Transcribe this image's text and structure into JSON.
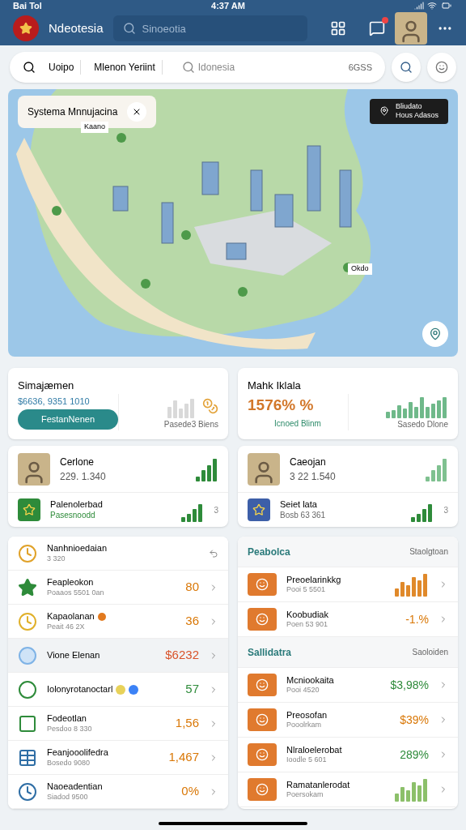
{
  "status_bar": {
    "carrier": "Bai Tol",
    "time": "4:37 AM"
  },
  "app_bar": {
    "title": "Ndeotesia",
    "search": {
      "placeholder": "Sinoeotia"
    },
    "notification_badge": true
  },
  "filter_bar": {
    "items": [
      "Uoipo",
      "Mlenon Yeriint"
    ],
    "search": {
      "placeholder": "Idonesia"
    },
    "count": "6GSS"
  },
  "map": {
    "title": "Systema Mnnujacina",
    "info": {
      "line_1": "Bliudato",
      "line_2": "Hous Adasos"
    },
    "labels": [
      "Kaano",
      "Okdo"
    ]
  },
  "stats": [
    {
      "kind": "button",
      "title": "Simajæmen",
      "value": "$6636, 9351 1010",
      "button": "FestanNenen",
      "caption": "Pasede3 Biens"
    },
    {
      "kind": "link",
      "title": "Mahk Iklala",
      "value": "1576% %",
      "link": "Icnoed Blinm",
      "caption": "Sasedo Dlone"
    }
  ],
  "people": [
    {
      "name": "Cerlone",
      "value": "229. 1.340",
      "sub_title": "Palenolerbad",
      "sub_value": "Pasesnoodd",
      "count": "3"
    },
    {
      "name": "Caeojan",
      "value": "3 22 1.540",
      "sub_title": "Seiet lata",
      "sub_value": "Bosb 63 361",
      "count": "3"
    }
  ],
  "left_list": [
    {
      "title": "Nanhnioedaian",
      "subtitle": "3 320",
      "selected": false
    },
    {
      "title": "Feapleokon",
      "subtitle": "Poaaos 5501 0an",
      "value": "80",
      "color": "#d97706",
      "selected": false
    },
    {
      "title": "Kapaolanan",
      "subtitle": "Peait 46 2X",
      "value": "36",
      "color": "#d97706",
      "selected": false
    },
    {
      "title": "Vione Elenan",
      "value": "$6232",
      "color": "#d9532a",
      "selected": true
    },
    {
      "title": "Iolonyrotanoctarl",
      "value": "57",
      "color": "#2e8b3a",
      "selected": false
    },
    {
      "title": "Fodeotlan",
      "subtitle": "Pesdoo 8 330",
      "value": "1,56",
      "color": "#d97706",
      "selected": false
    },
    {
      "title": "Feanjooolifedra",
      "subtitle": "Bosedo 9080",
      "value": "1,467",
      "color": "#d97706",
      "selected": false
    },
    {
      "title": "Naoeadentian",
      "subtitle": "Siadod 9500",
      "value": "0%",
      "color": "#d97706",
      "selected": false
    }
  ],
  "right_list": [
    {
      "title": "Peabolca",
      "action": "Staolgtoan",
      "rows": [
        {
          "kind": "bars",
          "title": "Preoelarinkkg",
          "subtitle": "Pooi 5 5501"
        },
        {
          "kind": "value",
          "title": "Koobudiak",
          "subtitle": "Poen 53 901",
          "value": "-1.%",
          "color": "#d97706"
        }
      ]
    },
    {
      "title": "Sallidatra",
      "action": "Saoloiden",
      "rows": [
        {
          "kind": "value",
          "title": "Mcniookaita",
          "subtitle": "Pooi 4520",
          "value": "$3,98%",
          "color": "#2e8b3a"
        },
        {
          "kind": "value",
          "title": "Preosofan",
          "subtitle": "Pooolrkam",
          "value": "$39%",
          "color": "#d97706"
        },
        {
          "kind": "value",
          "title": "Nlraloelerobat",
          "subtitle": "Ioodle 5 601",
          "value": "289%",
          "color": "#2e8b3a"
        },
        {
          "kind": "bars",
          "title": "Ramatanlerodat",
          "subtitle": "Poersokam"
        }
      ]
    }
  ]
}
